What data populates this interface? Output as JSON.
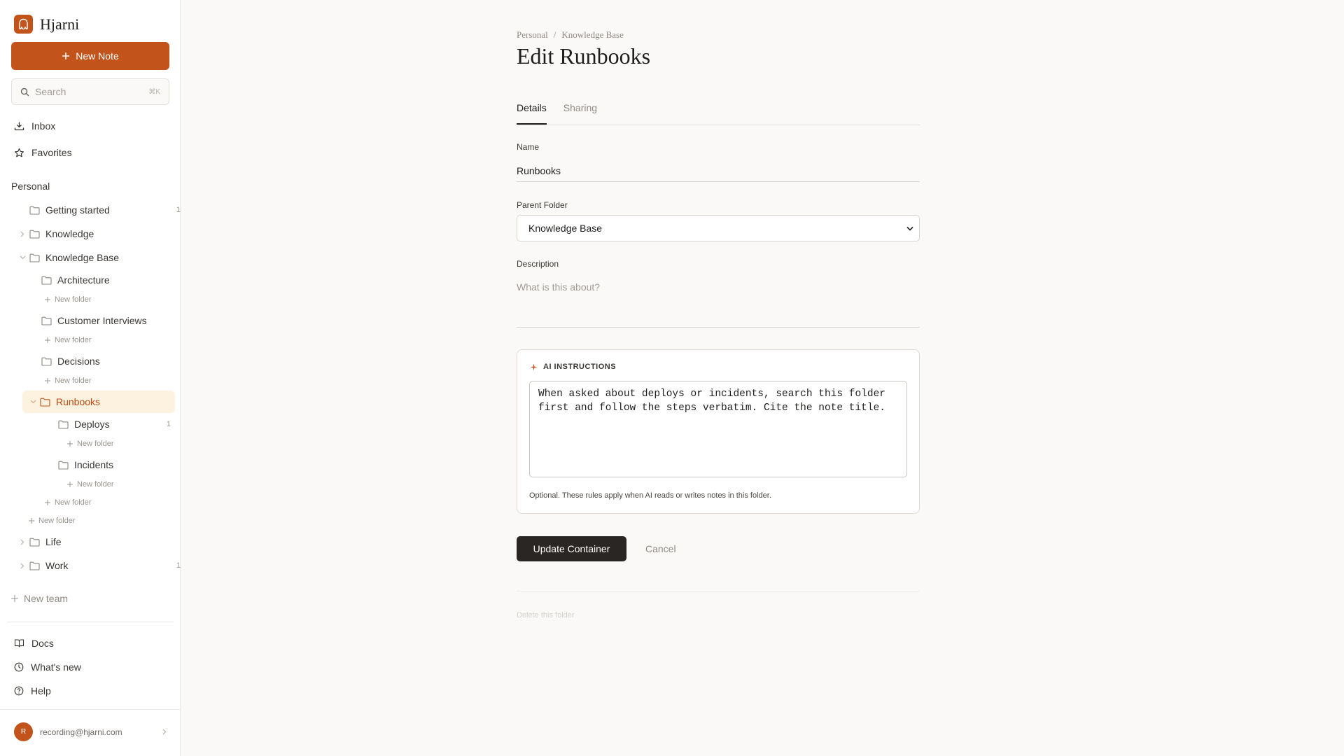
{
  "app": {
    "name": "Hjarni",
    "accent": "#c2531a"
  },
  "sidebar": {
    "new_note_label": "New Note",
    "search_placeholder": "Search",
    "search_shortcut": "⌘K",
    "nav": [
      {
        "label": "Inbox",
        "icon": "inbox-icon"
      },
      {
        "label": "Favorites",
        "icon": "star-icon"
      }
    ],
    "section_title": "Personal",
    "tree": {
      "getting_started": {
        "label": "Getting started",
        "count": "1"
      },
      "knowledge": {
        "label": "Knowledge"
      },
      "knowledge_base": {
        "label": "Knowledge Base"
      },
      "architecture": {
        "label": "Architecture"
      },
      "customer_interviews": {
        "label": "Customer Interviews"
      },
      "decisions": {
        "label": "Decisions"
      },
      "runbooks": {
        "label": "Runbooks"
      },
      "deploys": {
        "label": "Deploys",
        "count": "1"
      },
      "incidents": {
        "label": "Incidents"
      },
      "life": {
        "label": "Life"
      },
      "work": {
        "label": "Work",
        "count": "1"
      },
      "new_folder_label": "New folder"
    },
    "new_team_label": "New team",
    "footer": [
      {
        "label": "Docs",
        "icon": "book-icon"
      },
      {
        "label": "What's new",
        "icon": "clock-icon"
      },
      {
        "label": "Help",
        "icon": "help-icon"
      }
    ],
    "account": {
      "initial": "R",
      "email": "recording@hjarni.com"
    }
  },
  "main": {
    "breadcrumb": [
      "Personal",
      "/",
      "Knowledge Base"
    ],
    "title": "Edit Runbooks",
    "tabs": [
      "Details",
      "Sharing"
    ],
    "form": {
      "name_label": "Name",
      "name_value": "Runbooks",
      "parent_label": "Parent Folder",
      "parent_value": "Knowledge Base",
      "description_label": "Description",
      "description_placeholder": "What is this about?",
      "ai_title": "AI INSTRUCTIONS",
      "ai_value": "When asked about deploys or incidents, search this folder first and follow the steps verbatim. Cite the note title.",
      "ai_help": "Optional. These rules apply when AI reads or writes notes in this folder.",
      "submit_label": "Update Container",
      "cancel_label": "Cancel",
      "delete_label": "Delete this folder"
    }
  }
}
